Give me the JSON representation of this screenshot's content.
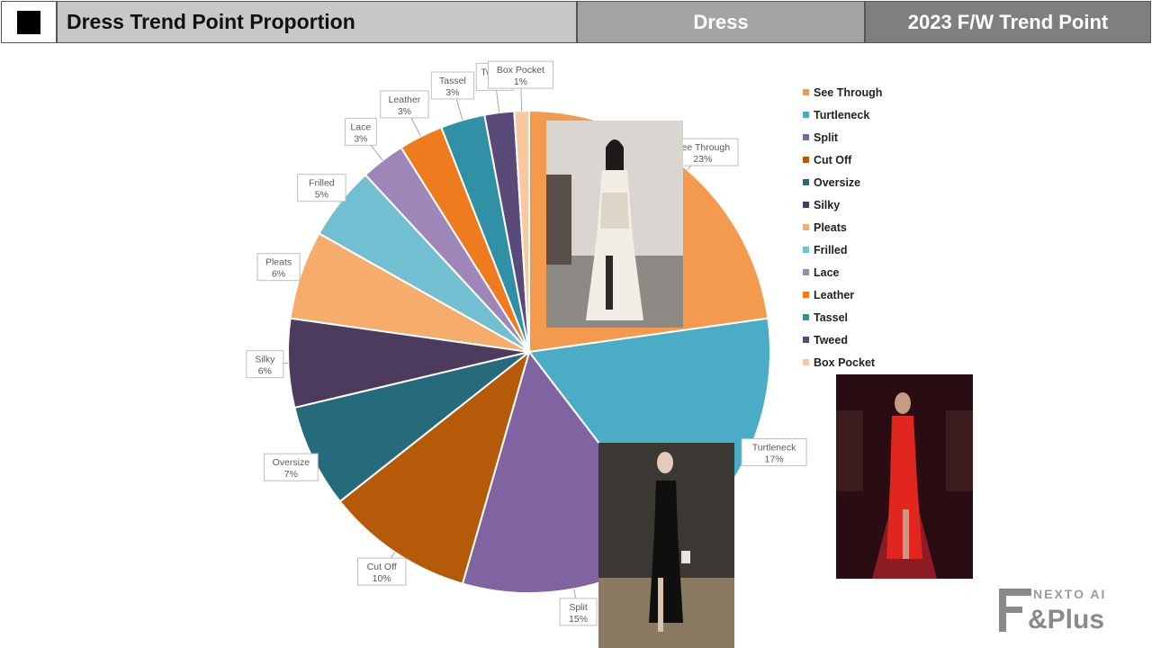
{
  "header": {
    "title": "Dress Trend Point Proportion",
    "category": "Dress",
    "trend": "2023 F/W Trend Point"
  },
  "chart_data": {
    "type": "pie",
    "title": "",
    "legend_position": "right",
    "categories": [
      "See Through",
      "Turtleneck",
      "Split",
      "Cut Off",
      "Oversize",
      "Silky",
      "Pleats",
      "Frilled",
      "Lace",
      "Leather",
      "Tassel",
      "Tweed",
      "Box Pocket"
    ],
    "values": [
      23,
      17,
      15,
      10,
      7,
      6,
      6,
      5,
      3,
      3,
      3,
      2,
      1
    ],
    "data_labels": [
      "23%",
      "17%",
      "15%",
      "10%",
      "7%",
      "6%",
      "6%",
      "5%",
      "3%",
      "3%",
      "3%",
      "2%",
      "1%"
    ],
    "colors": [
      "#F39A4E",
      "#4BACC6",
      "#8064A2",
      "#B55A08",
      "#256B7C",
      "#4D3A5F",
      "#F6AC6A",
      "#72BFD1",
      "#9E87B8",
      "#EE7C1E",
      "#3290A6",
      "#5A4A7A",
      "#F9C7A0"
    ],
    "start_angle_deg": 0
  },
  "logo": {
    "text_top": "NEXTO AI",
    "text_bottom": "F&Plus"
  }
}
